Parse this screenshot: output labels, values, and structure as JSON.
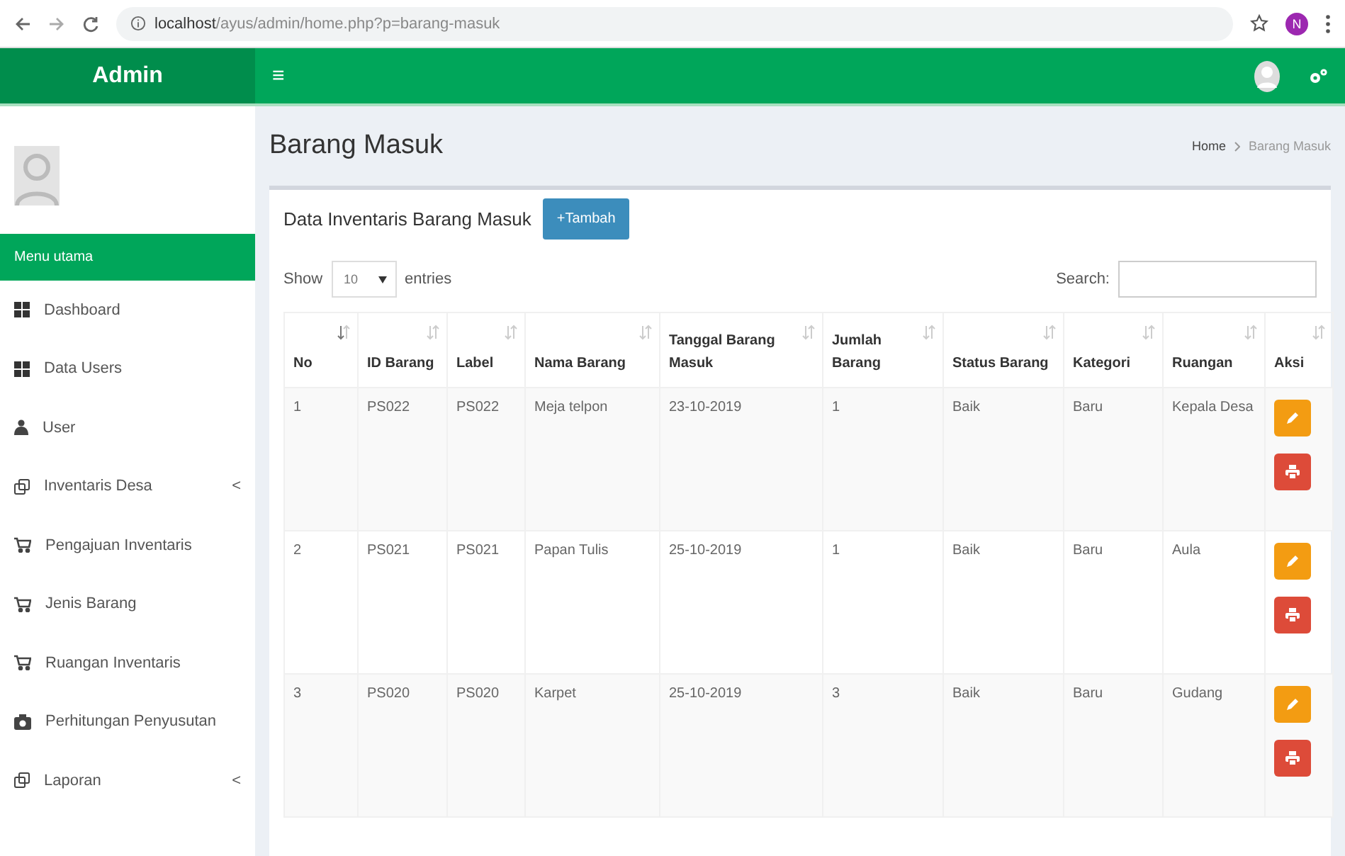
{
  "browser": {
    "url": "**localhost**/ayus/admin/home.php?p=barang-masuk",
    "profile": "N"
  },
  "header": {
    "brand": "Admin",
    "menu_toggle": "≡"
  },
  "sidebar": {
    "section": "Menu utama",
    "items": [
      {
        "label": "Dashboard",
        "kind": "grid"
      },
      {
        "label": "Data Users",
        "kind": "grid"
      },
      {
        "label": "User",
        "kind": "person"
      },
      {
        "label": "Inventaris Desa",
        "kind": "copy",
        "chevron": "<"
      },
      {
        "label": "Pengajuan Inventaris",
        "kind": "cart"
      },
      {
        "label": "Jenis Barang",
        "kind": "cart"
      },
      {
        "label": "Ruangan Inventaris",
        "kind": "cart"
      },
      {
        "label": "Perhitungan Penyusutan",
        "kind": "camera"
      },
      {
        "label": "Laporan",
        "kind": "copy",
        "chevron": "<"
      }
    ]
  },
  "page": {
    "title": "Barang Masuk",
    "breadcrumb": [
      "Home",
      "Barang Masuk"
    ]
  },
  "box": {
    "title": "Data Inventaris Barang Masuk",
    "add_button": "+Tambah",
    "show_label": "Show",
    "page_size": "10",
    "entries_label": "entries",
    "search_label": "Search:"
  },
  "table": {
    "columns": [
      {
        "label": "No",
        "sorted": true
      },
      {
        "label": "ID Barang",
        "sorted": false
      },
      {
        "label": "Label",
        "sorted": false
      },
      {
        "label": "Nama Barang",
        "sorted": false
      },
      {
        "label": "Tanggal Barang Masuk",
        "sorted": false
      },
      {
        "label": "Jumlah Barang",
        "sorted": false
      },
      {
        "label": "Status Barang",
        "sorted": false
      },
      {
        "label": "Kategori",
        "sorted": false
      },
      {
        "label": "Ruangan",
        "sorted": false
      },
      {
        "label": "Aksi",
        "sorted": false
      }
    ],
    "rows": [
      [
        "1",
        "PS022",
        "PS022",
        "Meja telpon",
        "23-10-2019",
        "1",
        "Baik",
        "Baru",
        "Kepala Desa"
      ],
      [
        "2",
        "PS021",
        "PS021",
        "Papan Tulis",
        "25-10-2019",
        "1",
        "Baik",
        "Baru",
        "Aula"
      ],
      [
        "3",
        "PS020",
        "PS020",
        "Karpet",
        "25-10-2019",
        "3",
        "Baik",
        "Baru",
        "Gudang"
      ]
    ]
  }
}
